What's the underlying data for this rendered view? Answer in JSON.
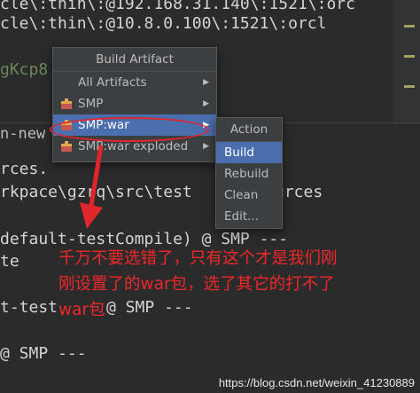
{
  "console": {
    "lines": [
      "cle\\:thin\\:@192.168.31.140\\:1521\\:orc",
      "cle\\:thin\\:@10.8.0.100\\:1521\\:orcl",
      "gKcp8",
      "n-new",
      "rces.",
      "rkpace\\gzrq\\src\\test",
      "urces",
      "default-testCompile) @ SMP ---",
      "te",
      "t-test",
      "@ SMP ---",
      "@ SMP ---"
    ]
  },
  "build_menu": {
    "title": "Build Artifact",
    "items": [
      {
        "label": "All Artifacts",
        "icon": ""
      },
      {
        "label": "SMP",
        "icon": "artifact-icon"
      },
      {
        "label": "SMP:war",
        "icon": "artifact-icon"
      },
      {
        "label": "SMP:war exploded",
        "icon": "artifact-icon"
      }
    ],
    "selected": "SMP:war"
  },
  "action_menu": {
    "title": "Action",
    "items": [
      "Build",
      "Rebuild",
      "Clean",
      "Edit..."
    ],
    "selected": "Build"
  },
  "annotation": {
    "line1": "千万不要选错了，只有这个才是我们刚",
    "line2": "刚设置了的war包，选了其它的打不了",
    "line3": "war包"
  },
  "watermark": "https://blog.csdn.net/weixin_41230889",
  "colors": {
    "background": "#2b2b2b",
    "menu_bg": "#3c3f41",
    "selection": "#4b6eaf",
    "annotation": "#e0262a"
  }
}
